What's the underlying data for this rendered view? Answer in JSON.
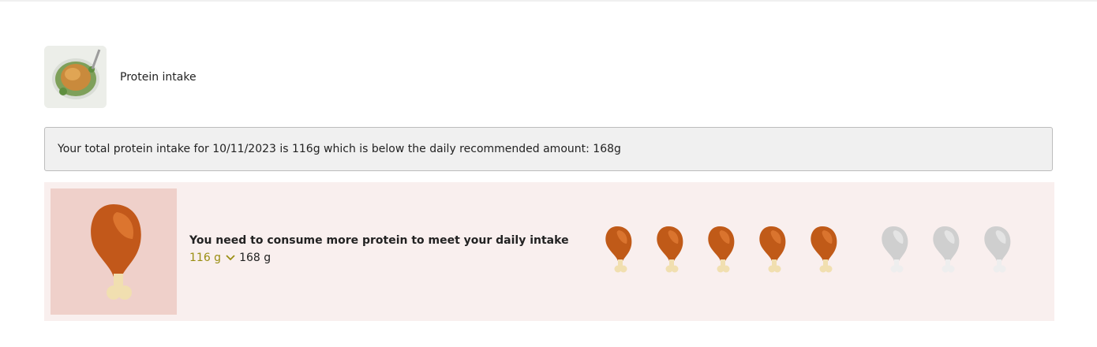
{
  "header": {
    "title": "Protein intake",
    "thumbnail_icon": "roast-chicken-image"
  },
  "summary": {
    "text": "Your total protein intake for 10/11/2023 is 116g which is below the daily recommended amount: 168g"
  },
  "panel": {
    "icon": "drumstick-icon",
    "message": "You need to consume more protein to meet your daily intake",
    "current_value": "116 g",
    "target_value": "168 g",
    "filled_drumsticks": 5,
    "total_drumsticks": 8
  },
  "colors": {
    "panel_background": "#f9efee",
    "icon_box_background": "#efd0ca",
    "current_value_color": "#9a8e12",
    "drumstick_filled": "#c05a18",
    "drumstick_empty": "#cfcfcf"
  }
}
